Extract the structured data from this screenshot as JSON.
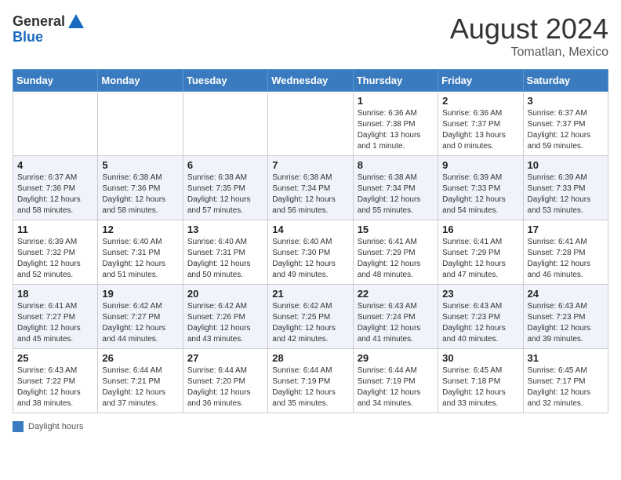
{
  "logo": {
    "general": "General",
    "blue": "Blue"
  },
  "header": {
    "month": "August 2024",
    "location": "Tomatlan, Mexico"
  },
  "weekdays": [
    "Sunday",
    "Monday",
    "Tuesday",
    "Wednesday",
    "Thursday",
    "Friday",
    "Saturday"
  ],
  "weeks": [
    [
      {
        "day": "",
        "sunrise": "",
        "sunset": "",
        "daylight": ""
      },
      {
        "day": "",
        "sunrise": "",
        "sunset": "",
        "daylight": ""
      },
      {
        "day": "",
        "sunrise": "",
        "sunset": "",
        "daylight": ""
      },
      {
        "day": "",
        "sunrise": "",
        "sunset": "",
        "daylight": ""
      },
      {
        "day": "1",
        "sunrise": "Sunrise: 6:36 AM",
        "sunset": "Sunset: 7:38 PM",
        "daylight": "Daylight: 13 hours and 1 minute."
      },
      {
        "day": "2",
        "sunrise": "Sunrise: 6:36 AM",
        "sunset": "Sunset: 7:37 PM",
        "daylight": "Daylight: 13 hours and 0 minutes."
      },
      {
        "day": "3",
        "sunrise": "Sunrise: 6:37 AM",
        "sunset": "Sunset: 7:37 PM",
        "daylight": "Daylight: 12 hours and 59 minutes."
      }
    ],
    [
      {
        "day": "4",
        "sunrise": "Sunrise: 6:37 AM",
        "sunset": "Sunset: 7:36 PM",
        "daylight": "Daylight: 12 hours and 58 minutes."
      },
      {
        "day": "5",
        "sunrise": "Sunrise: 6:38 AM",
        "sunset": "Sunset: 7:36 PM",
        "daylight": "Daylight: 12 hours and 58 minutes."
      },
      {
        "day": "6",
        "sunrise": "Sunrise: 6:38 AM",
        "sunset": "Sunset: 7:35 PM",
        "daylight": "Daylight: 12 hours and 57 minutes."
      },
      {
        "day": "7",
        "sunrise": "Sunrise: 6:38 AM",
        "sunset": "Sunset: 7:34 PM",
        "daylight": "Daylight: 12 hours and 56 minutes."
      },
      {
        "day": "8",
        "sunrise": "Sunrise: 6:38 AM",
        "sunset": "Sunset: 7:34 PM",
        "daylight": "Daylight: 12 hours and 55 minutes."
      },
      {
        "day": "9",
        "sunrise": "Sunrise: 6:39 AM",
        "sunset": "Sunset: 7:33 PM",
        "daylight": "Daylight: 12 hours and 54 minutes."
      },
      {
        "day": "10",
        "sunrise": "Sunrise: 6:39 AM",
        "sunset": "Sunset: 7:33 PM",
        "daylight": "Daylight: 12 hours and 53 minutes."
      }
    ],
    [
      {
        "day": "11",
        "sunrise": "Sunrise: 6:39 AM",
        "sunset": "Sunset: 7:32 PM",
        "daylight": "Daylight: 12 hours and 52 minutes."
      },
      {
        "day": "12",
        "sunrise": "Sunrise: 6:40 AM",
        "sunset": "Sunset: 7:31 PM",
        "daylight": "Daylight: 12 hours and 51 minutes."
      },
      {
        "day": "13",
        "sunrise": "Sunrise: 6:40 AM",
        "sunset": "Sunset: 7:31 PM",
        "daylight": "Daylight: 12 hours and 50 minutes."
      },
      {
        "day": "14",
        "sunrise": "Sunrise: 6:40 AM",
        "sunset": "Sunset: 7:30 PM",
        "daylight": "Daylight: 12 hours and 49 minutes."
      },
      {
        "day": "15",
        "sunrise": "Sunrise: 6:41 AM",
        "sunset": "Sunset: 7:29 PM",
        "daylight": "Daylight: 12 hours and 48 minutes."
      },
      {
        "day": "16",
        "sunrise": "Sunrise: 6:41 AM",
        "sunset": "Sunset: 7:29 PM",
        "daylight": "Daylight: 12 hours and 47 minutes."
      },
      {
        "day": "17",
        "sunrise": "Sunrise: 6:41 AM",
        "sunset": "Sunset: 7:28 PM",
        "daylight": "Daylight: 12 hours and 46 minutes."
      }
    ],
    [
      {
        "day": "18",
        "sunrise": "Sunrise: 6:41 AM",
        "sunset": "Sunset: 7:27 PM",
        "daylight": "Daylight: 12 hours and 45 minutes."
      },
      {
        "day": "19",
        "sunrise": "Sunrise: 6:42 AM",
        "sunset": "Sunset: 7:27 PM",
        "daylight": "Daylight: 12 hours and 44 minutes."
      },
      {
        "day": "20",
        "sunrise": "Sunrise: 6:42 AM",
        "sunset": "Sunset: 7:26 PM",
        "daylight": "Daylight: 12 hours and 43 minutes."
      },
      {
        "day": "21",
        "sunrise": "Sunrise: 6:42 AM",
        "sunset": "Sunset: 7:25 PM",
        "daylight": "Daylight: 12 hours and 42 minutes."
      },
      {
        "day": "22",
        "sunrise": "Sunrise: 6:43 AM",
        "sunset": "Sunset: 7:24 PM",
        "daylight": "Daylight: 12 hours and 41 minutes."
      },
      {
        "day": "23",
        "sunrise": "Sunrise: 6:43 AM",
        "sunset": "Sunset: 7:23 PM",
        "daylight": "Daylight: 12 hours and 40 minutes."
      },
      {
        "day": "24",
        "sunrise": "Sunrise: 6:43 AM",
        "sunset": "Sunset: 7:23 PM",
        "daylight": "Daylight: 12 hours and 39 minutes."
      }
    ],
    [
      {
        "day": "25",
        "sunrise": "Sunrise: 6:43 AM",
        "sunset": "Sunset: 7:22 PM",
        "daylight": "Daylight: 12 hours and 38 minutes."
      },
      {
        "day": "26",
        "sunrise": "Sunrise: 6:44 AM",
        "sunset": "Sunset: 7:21 PM",
        "daylight": "Daylight: 12 hours and 37 minutes."
      },
      {
        "day": "27",
        "sunrise": "Sunrise: 6:44 AM",
        "sunset": "Sunset: 7:20 PM",
        "daylight": "Daylight: 12 hours and 36 minutes."
      },
      {
        "day": "28",
        "sunrise": "Sunrise: 6:44 AM",
        "sunset": "Sunset: 7:19 PM",
        "daylight": "Daylight: 12 hours and 35 minutes."
      },
      {
        "day": "29",
        "sunrise": "Sunrise: 6:44 AM",
        "sunset": "Sunset: 7:19 PM",
        "daylight": "Daylight: 12 hours and 34 minutes."
      },
      {
        "day": "30",
        "sunrise": "Sunrise: 6:45 AM",
        "sunset": "Sunset: 7:18 PM",
        "daylight": "Daylight: 12 hours and 33 minutes."
      },
      {
        "day": "31",
        "sunrise": "Sunrise: 6:45 AM",
        "sunset": "Sunset: 7:17 PM",
        "daylight": "Daylight: 12 hours and 32 minutes."
      }
    ]
  ],
  "footer": {
    "label": "Daylight hours"
  }
}
